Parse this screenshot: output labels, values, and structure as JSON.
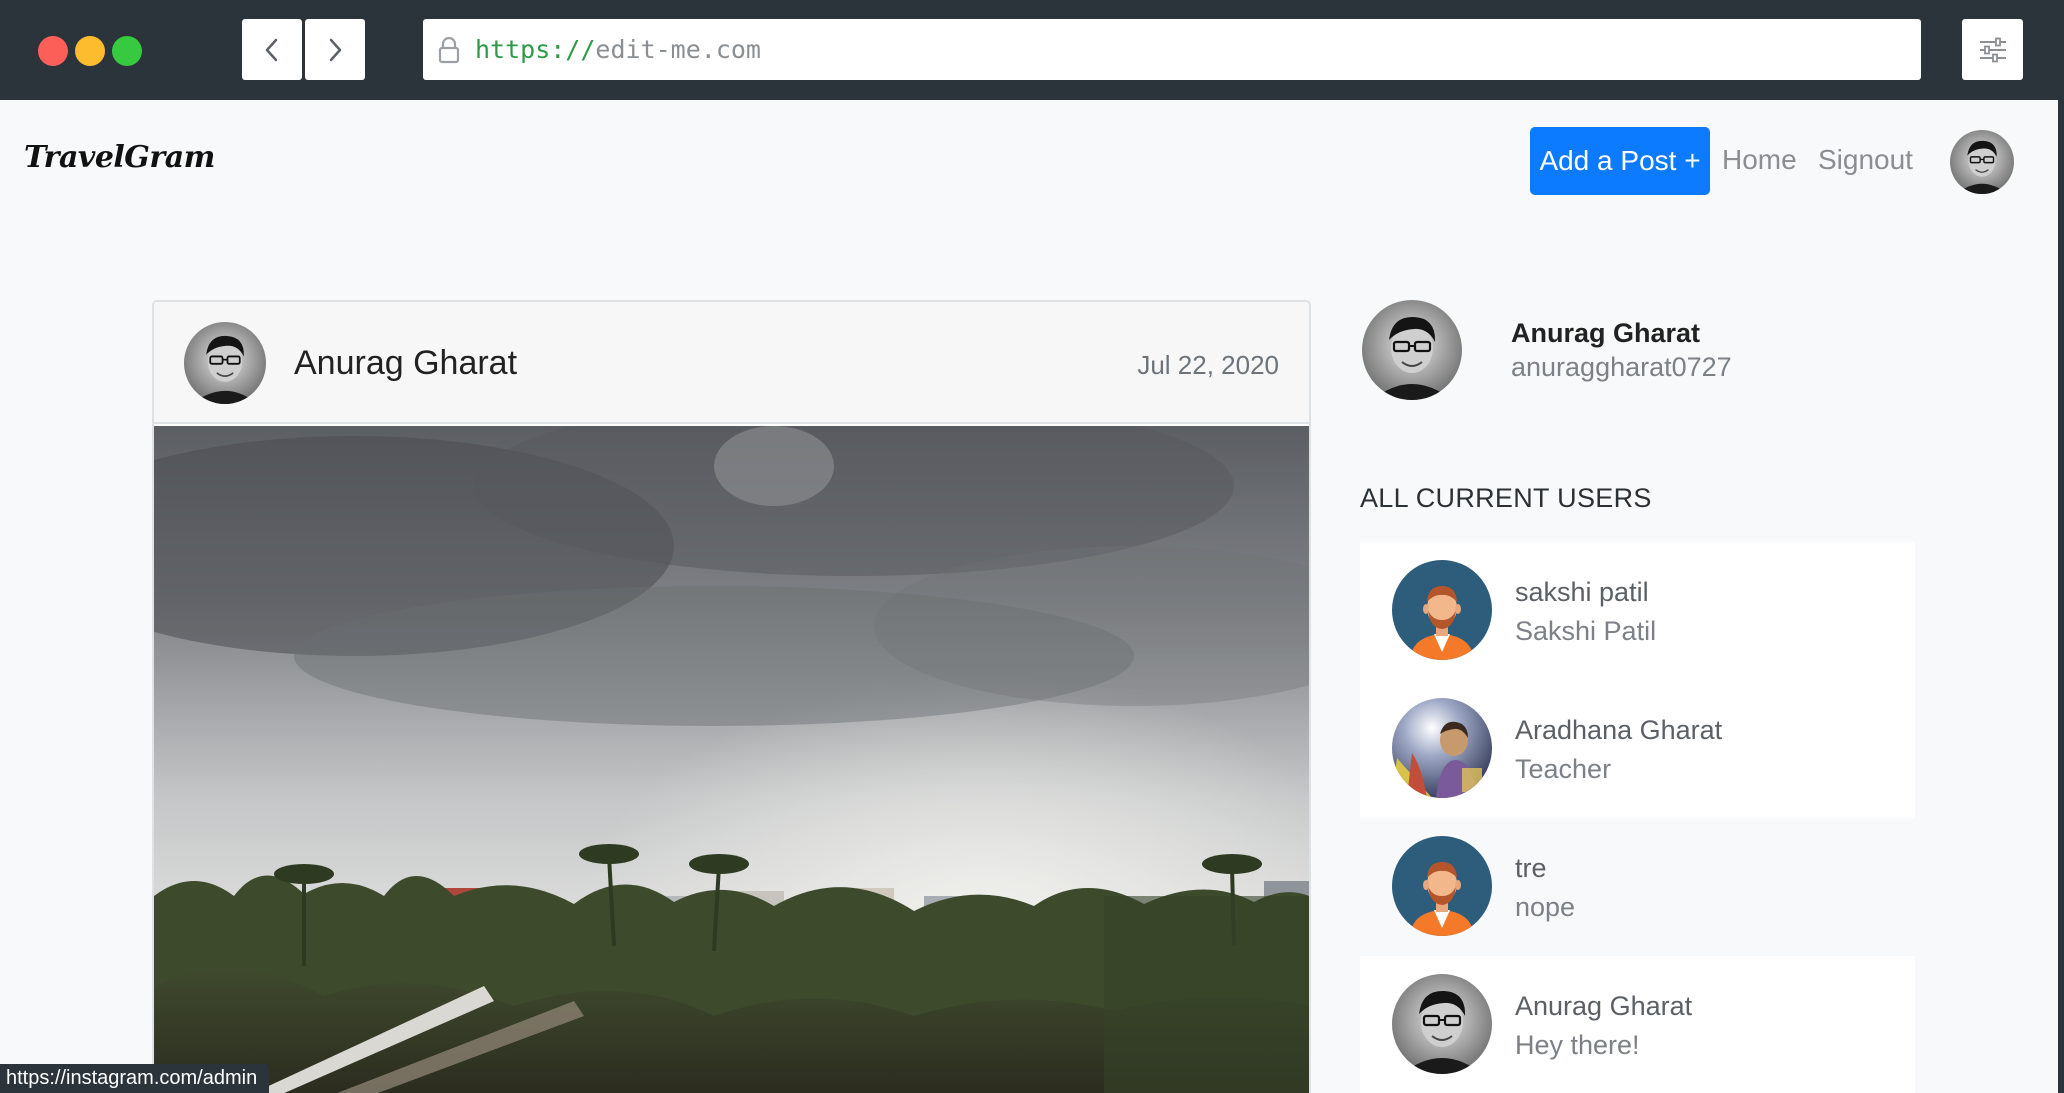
{
  "browser": {
    "url_protocol": "https://",
    "url_host": "edit-me.com"
  },
  "navbar": {
    "logo": "TravelGram",
    "add_post": "Add a Post +",
    "home": "Home",
    "signout": "Signout"
  },
  "post": {
    "author": "Anurag Gharat",
    "date": "Jul 22, 2020"
  },
  "profile": {
    "name": "Anurag Gharat",
    "username": "anuraggharat0727"
  },
  "users": {
    "heading": "ALL CURRENT USERS",
    "items": [
      {
        "name": "sakshi patil",
        "bio": "Sakshi Patil",
        "avatar": "cartoon-avatar-icon"
      },
      {
        "name": "Aradhana Gharat",
        "bio": "Teacher",
        "avatar": "photo-avatar"
      },
      {
        "name": "tre",
        "bio": "nope",
        "avatar": "cartoon-avatar-icon"
      },
      {
        "name": "Anurag Gharat",
        "bio": "Hey there!",
        "avatar": "photo-avatar"
      }
    ]
  },
  "status_bar": "https://instagram.com/admin",
  "colors": {
    "primary": "#0d7bff",
    "chrome": "#2b333b",
    "page_bg": "#f8f9fa"
  }
}
